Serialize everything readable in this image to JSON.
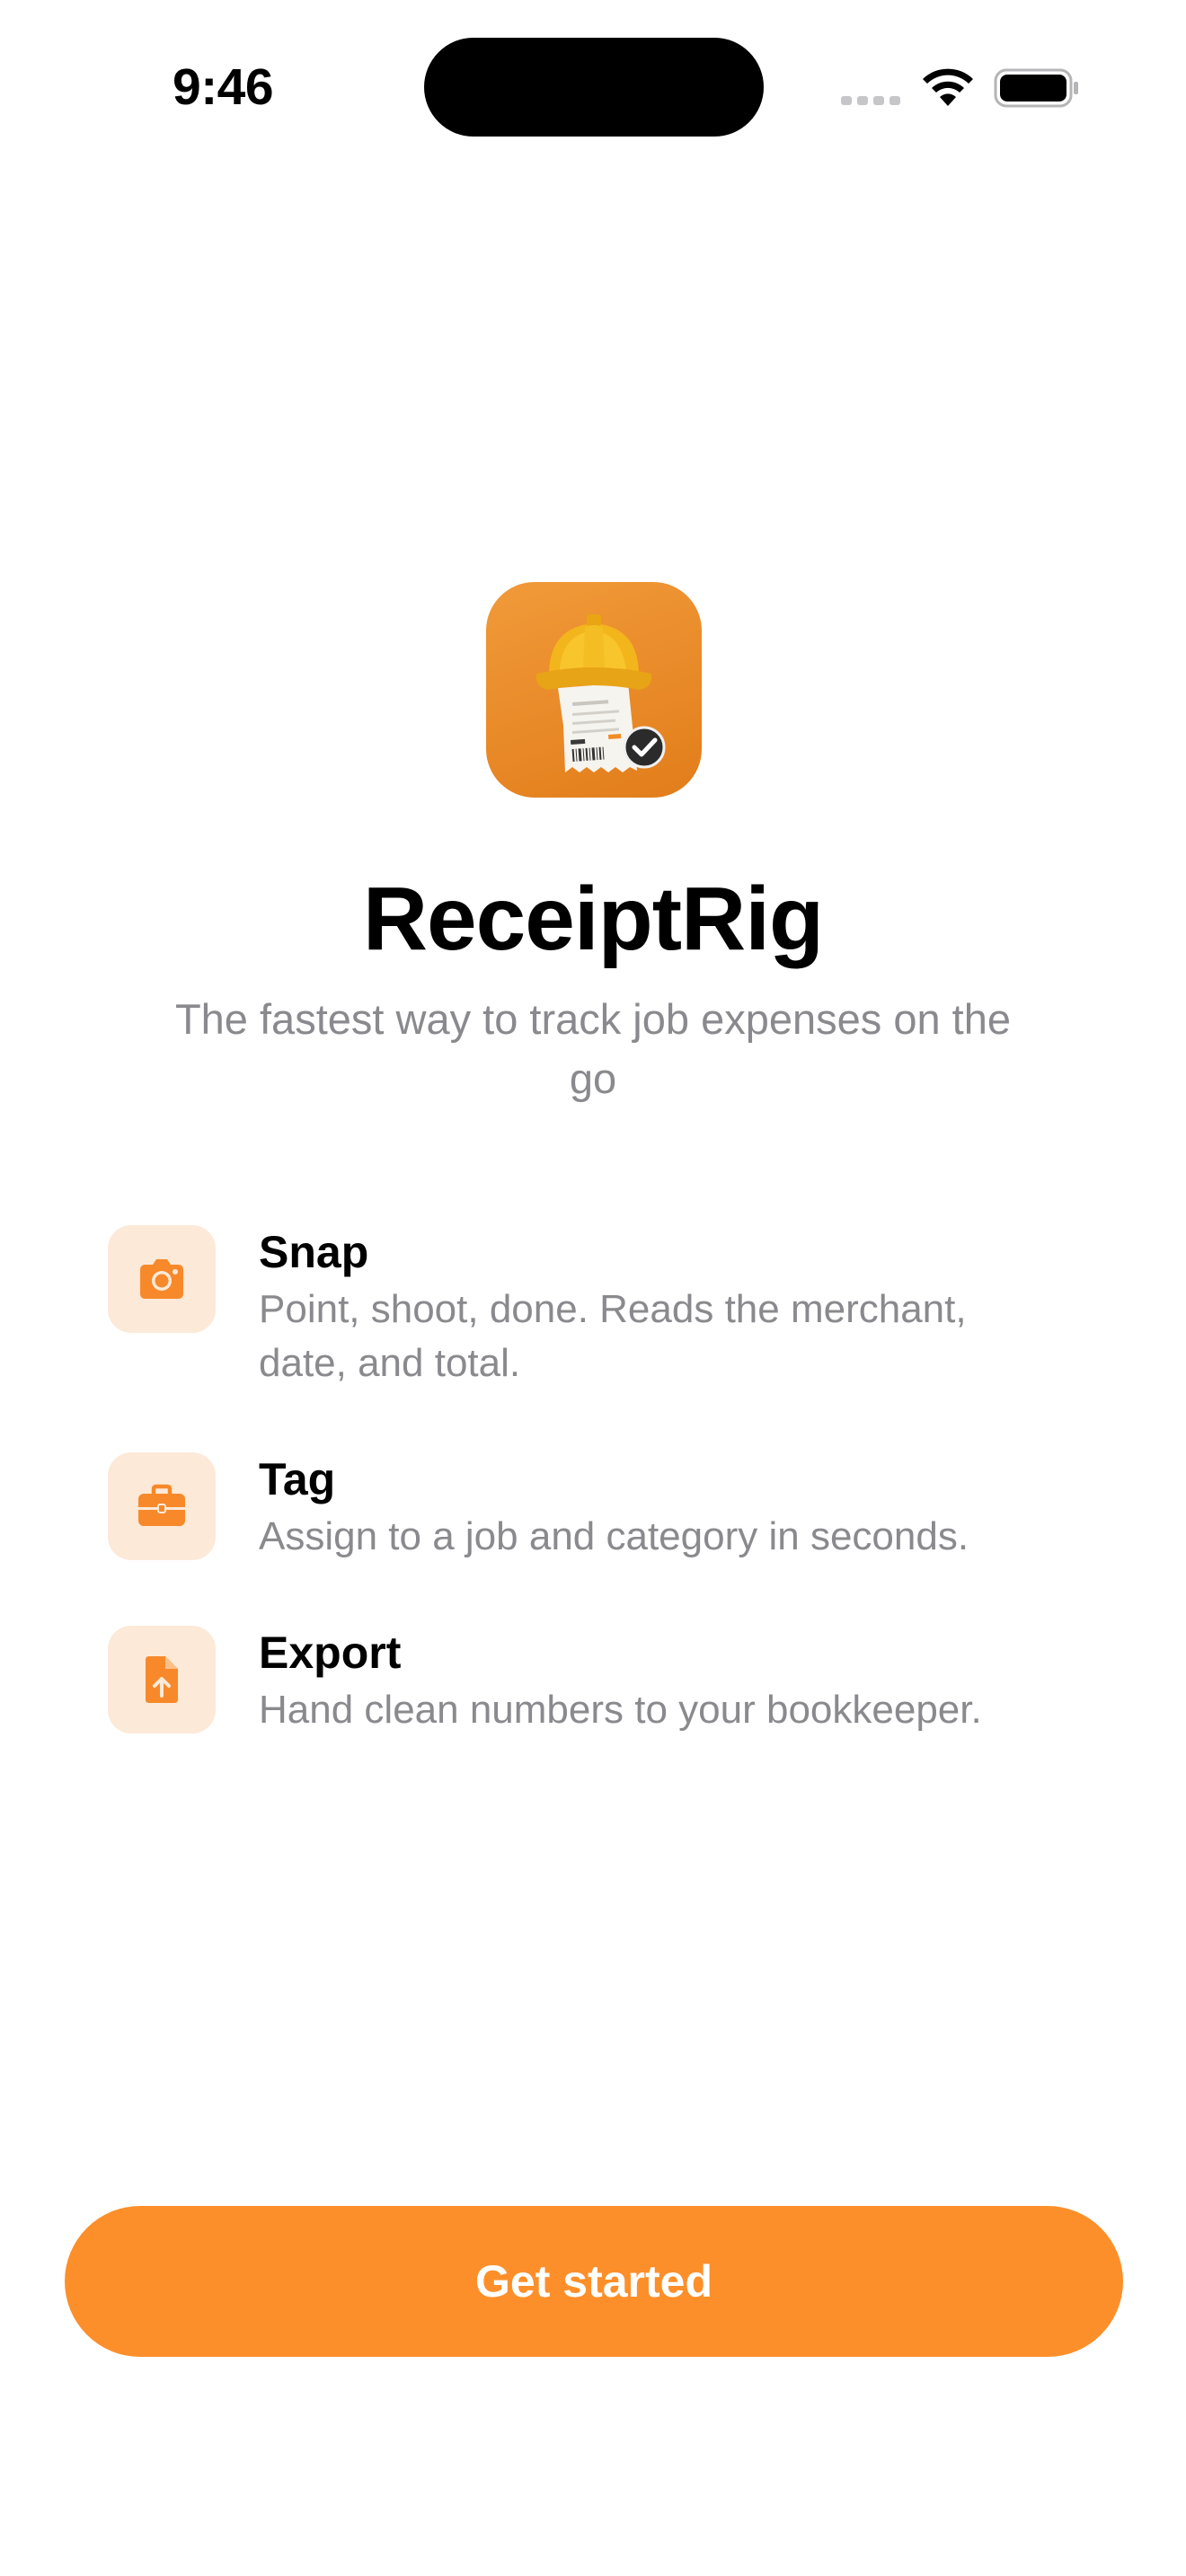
{
  "status_bar": {
    "time": "9:46",
    "icons": [
      "cellular-signal-icon",
      "wifi-icon",
      "battery-icon"
    ]
  },
  "hero": {
    "app_icon": "receipt-with-hard-hat-icon",
    "title": "ReceiptRig",
    "subtitle": "The fastest way to track job expenses on the go"
  },
  "features": [
    {
      "icon": "camera-icon",
      "title": "Snap",
      "description": "Point, shoot, done. Reads the merchant, date, and total."
    },
    {
      "icon": "briefcase-icon",
      "title": "Tag",
      "description": "Assign to a job and category in seconds."
    },
    {
      "icon": "document-upload-icon",
      "title": "Export",
      "description": "Hand clean numbers to your bookkeeper."
    }
  ],
  "cta": {
    "label": "Get started"
  },
  "colors": {
    "accent": "#fd8f2a",
    "icon_tile_bg": "#fde9d8",
    "secondary_text": "#8a8a8e",
    "primary_text": "#000000"
  }
}
